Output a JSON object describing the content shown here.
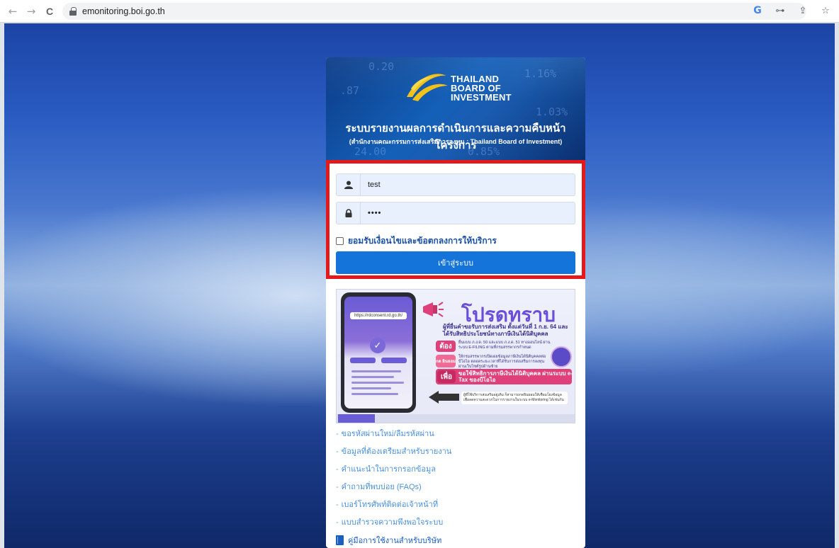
{
  "browser": {
    "url": "emonitoring.boi.go.th",
    "back_icon": "←",
    "forward_icon": "→",
    "reload_icon": "C",
    "google_icon": "G",
    "key_icon": "⊶",
    "share_icon": "⇪",
    "star_icon": "☆"
  },
  "banner": {
    "logo_line1": "THAILAND",
    "logo_line2": "BOARD OF",
    "logo_line3": "INVESTMENT",
    "title": "ระบบรายงานผลการดำเนินการและความคืบหน้าโครงการ",
    "subtitle": "(สำนักงานคณะกรรมการส่งเสริมการลงทุน : Thailand Board of Investment)"
  },
  "login": {
    "username_value": "test",
    "password_value": "••••",
    "terms_label": "ยอมรับเงื่อนไขและข้อตกลงการให้บริการ",
    "terms_checked": false,
    "submit_label": "เข้าสู่ระบบ"
  },
  "poster": {
    "title": "โปรดทราบ",
    "subtitle": "ผู้ที่ยื่นคำขอรับการส่งเสริม ตั้งแต่วันที่ 1 ก.ย. 64 และได้รับสิทธิประโยชน์ทางภาษีเงินได้นิติบุคคล",
    "pill1": "ต้อง",
    "text1": "ยื่นแบบ ภ.ง.ด. 50 และแบบ ภ.ง.ด. 51 ทางออนไลน์ ผ่านระบบ E-FILING ตามที่กรมสรรพากรกำหนด",
    "pill2": "กด ยินยอม",
    "text2": "ให้กรมสรรพากรเปิดเผยข้อมูลภาษีเงินได้นิติบุคคลต่อบีโอไอ ตลอดระยะเวลาที่ได้รับการส่งเสริมการลงทุน ผ่านเว็บไซต์รูปด้านซ้าย",
    "pill3": "เพื่อ",
    "bar_text": "ขอใช้สิทธิการภาษีเงินได้นิติบุคคล ผ่านระบบ e-Tax ของบีโอไอ",
    "phone_url": "https://rdconsent.rd.go.th/",
    "foot_text": "ผู้ที่ใช้บริการส่งเสริมอยู่เดิม ก็สามารถกดยินยอมให้เชื่อมโยงข้อมูล เพื่อลดความสะดวกในการรายงานในระบบ e-Monitoring ได้เช่นกัน"
  },
  "links": [
    "ขอรหัสผ่านใหม่/ลืมรหัสผ่าน",
    "ข้อมูลที่ต้องเตรียมสำหรับรายงาน",
    "คำแนะนำในการกรอกข้อมูล",
    "คำถามที่พบบ่อย (FAQs)",
    "เบอร์โทรศัพท์ติดต่อเจ้าหน้าที่",
    "แบบสำรวจความพึงพอใจระบบ"
  ],
  "manual_label": "คู่มือการใช้งานสำหรับบริษัท",
  "colors": {
    "highlight_border": "#e3191b",
    "button_blue": "#1574d9",
    "link_blue": "#4a90d9"
  }
}
